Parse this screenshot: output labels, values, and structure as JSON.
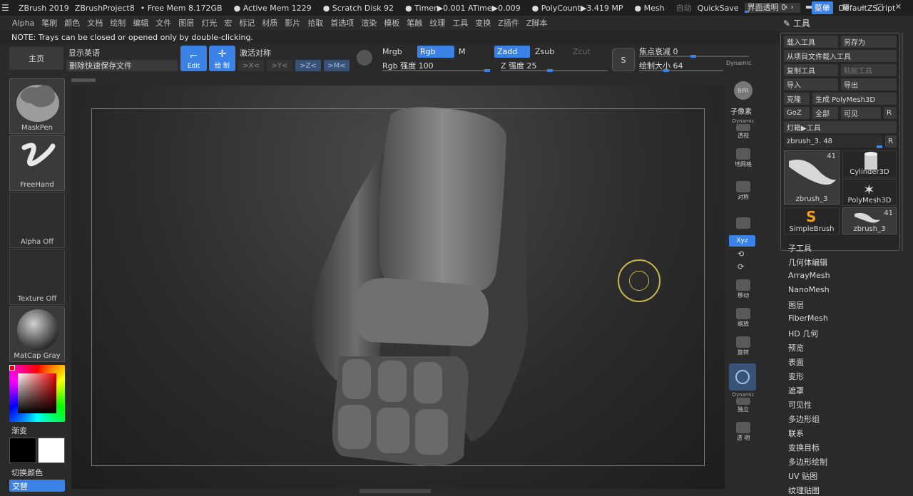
{
  "titlebar": {
    "app": "ZBrush 2019",
    "project": "ZBrushProject8",
    "free_mem": "Free Mem 8.172GB",
    "active_mem": "Active Mem 1229",
    "scratch": "Scratch Disk 92",
    "timer": "Timer▶0.001 ATime▶0.009",
    "polycount": "PolyCount▶3.419 MP",
    "mesh": "Mesh",
    "auto": "自动",
    "quicksave": "QuickSave",
    "transparency": "界面透明 0",
    "menu": "菜单",
    "script": "DefaultZScript"
  },
  "menubar": [
    "Alpha",
    "笔刷",
    "颜色",
    "文档",
    "绘制",
    "编辑",
    "文件",
    "图层",
    "灯光",
    "宏",
    "标记",
    "材质",
    "影片",
    "拾取",
    "首选项",
    "渲染",
    "模板",
    "笔触",
    "纹理",
    "工具",
    "变换",
    "Z插件",
    "Z脚本"
  ],
  "note": "NOTE: Trays can be closed or opened only by double-clicking.",
  "shelf": {
    "home": "主页",
    "show_english": "显示英语",
    "delete_quicksave": "删除快速保存文件",
    "edit": "Edit",
    "draw": "绘 制",
    "activate_symmetry": "激活对称",
    "x": ">X<",
    "y": ">Y<",
    "z": ">Z<",
    "m": ">M<",
    "mrgb": "Mrgb",
    "rgb": "Rgb",
    "m_btn": "M",
    "zadd": "Zadd",
    "zsub": "Zsub",
    "zcut": "Zcut",
    "rgb_intensity": "Rgb 强度 100",
    "z_intensity": "Z 强度 25",
    "focal_shift": "焦点衰减 0",
    "draw_size": "绘制大小 64",
    "dynamic": "Dynamic"
  },
  "left": {
    "brush": "MaskPen",
    "stroke": "FreeHand",
    "alpha": "Alpha Off",
    "texture": "Texture Off",
    "material": "MatCap Gray",
    "gradient": "渐变",
    "switch_color": "切换颜色",
    "alternate": "交替"
  },
  "rightshelf": {
    "bpr": "BPR",
    "subpixel": "子像素",
    "dynamic1": "Dynamic",
    "persp": "透视",
    "floor": "地网格",
    "local": "对称",
    "xyz": "Xyz",
    "move": "移动",
    "scale": "缩放",
    "rotate": "旋转",
    "dynamic2": "Dynamic",
    "solo": "独立",
    "transp": "透 明"
  },
  "tool": {
    "title": "工具",
    "load": "载入工具",
    "save_as": "另存为",
    "load_from_project": "从项目文件载入工具",
    "copy": "复制工具",
    "paste": "粘贴工具",
    "import": "导入",
    "export": "导出",
    "clone": "克隆",
    "make_polymesh": "生成 PolyMesh3D",
    "goz": "GoZ",
    "all": "全部",
    "visible": "可见",
    "r": "R",
    "lightbox": "灯箱▶工具",
    "current": "zbrush_3. 48",
    "thumbs": [
      {
        "label": "zbrush_3",
        "count": "41"
      },
      {
        "label": "Cylinder3D",
        "count": ""
      },
      {
        "label": "PolyMesh3D",
        "count": ""
      },
      {
        "label": "SimpleBrush",
        "count": ""
      },
      {
        "label": "zbrush_3",
        "count": "41"
      }
    ],
    "sections": [
      "子工具",
      "几何体编辑",
      "ArrayMesh",
      "NanoMesh",
      "图层",
      "FiberMesh",
      "HD 几何",
      "预览",
      "表面",
      "变形",
      "遮罩",
      "可见性",
      "多边形组",
      "联系",
      "变换目标",
      "多边形绘制",
      "UV 贴图",
      "纹理贴图"
    ]
  }
}
